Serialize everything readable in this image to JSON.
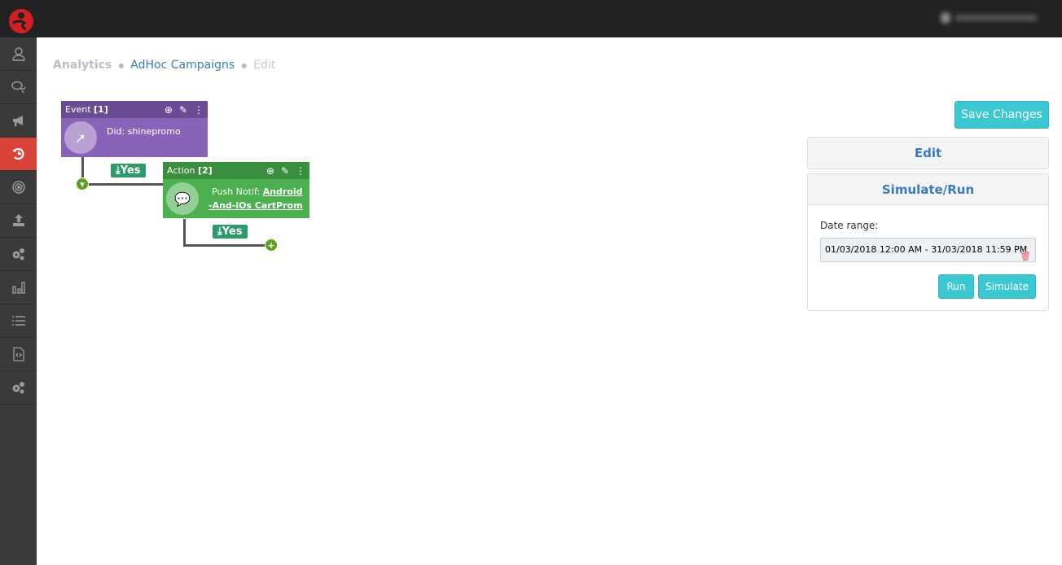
{
  "breadcrumb": {
    "items": [
      "Analytics",
      "AdHoc Campaigns",
      "Edit"
    ]
  },
  "sidebar": {
    "items": [
      {
        "icon": "user-icon"
      },
      {
        "icon": "chat-icon"
      },
      {
        "icon": "megaphone-icon"
      },
      {
        "icon": "history-icon",
        "active": true
      },
      {
        "icon": "target-icon"
      },
      {
        "icon": "upload-icon"
      },
      {
        "icon": "cogs-icon"
      },
      {
        "icon": "bar-chart-icon"
      },
      {
        "icon": "list-icon"
      },
      {
        "icon": "code-file-icon"
      },
      {
        "icon": "cogs-icon"
      }
    ]
  },
  "flow": {
    "event": {
      "title": "Event",
      "index": "[1]",
      "text": "Did: shinepromo",
      "color": "#8a63b8"
    },
    "action": {
      "title": "Action",
      "index": "[2]",
      "prefix": "Push Notif: ",
      "link": "Android-And-iOs CartProm",
      "link_line1": "Android",
      "link_line2": "-And-iOs CartProm",
      "color": "#4caf50"
    },
    "yes1": "Yes",
    "yes2": "Yes"
  },
  "right": {
    "save_label": "Save Changes",
    "edit_title": "Edit",
    "simulate_title": "Simulate/Run",
    "date_label": "Date range:",
    "date_value": "01/03/2018 12:00 AM - 31/03/2018 11:59 PM",
    "run_label": "Run",
    "simulate_label": "Simulate"
  },
  "colors": {
    "accent": "#3cc8d2",
    "active_nav": "#d9433a",
    "link": "#3a7bbf"
  }
}
